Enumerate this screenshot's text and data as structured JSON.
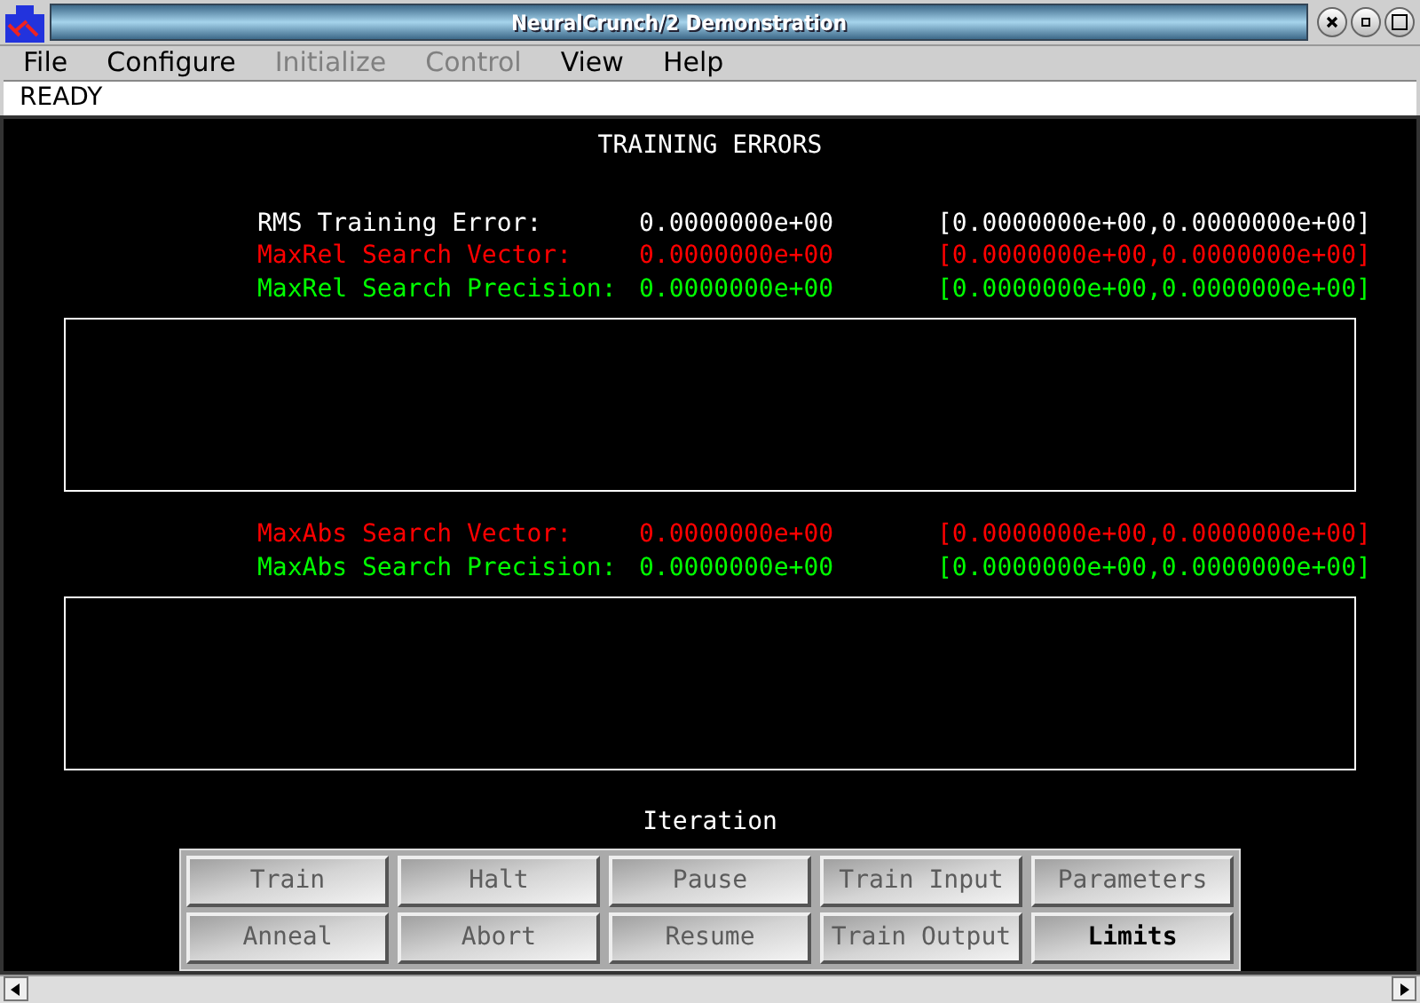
{
  "window": {
    "title": "NeuralCrunch/2 Demonstration"
  },
  "menu": [
    {
      "label": "File",
      "disabled": false
    },
    {
      "label": "Configure",
      "disabled": false
    },
    {
      "label": "Initialize",
      "disabled": true
    },
    {
      "label": "Control",
      "disabled": true
    },
    {
      "label": "View",
      "disabled": false
    },
    {
      "label": "Help",
      "disabled": false
    }
  ],
  "status": "READY",
  "heading": "TRAINING ERRORS",
  "group_1": [
    {
      "label": "RMS Training Error:",
      "value": "0.0000000e+00",
      "range": "[0.0000000e+00,0.0000000e+00]",
      "color": "#ffffff"
    },
    {
      "label": "MaxRel Search Vector:",
      "value": "0.0000000e+00",
      "range": "[0.0000000e+00,0.0000000e+00]",
      "color": "#ff0000"
    },
    {
      "label": "MaxRel Search Precision:",
      "value": "0.0000000e+00",
      "range": "[0.0000000e+00,0.0000000e+00]",
      "color": "#00ff00"
    }
  ],
  "group_2": [
    {
      "label": "MaxAbs Search Vector:",
      "value": "0.0000000e+00",
      "range": "[0.0000000e+00,0.0000000e+00]",
      "color": "#ff0000"
    },
    {
      "label": "MaxAbs Search Precision:",
      "value": "0.0000000e+00",
      "range": "[0.0000000e+00,0.0000000e+00]",
      "color": "#00ff00"
    }
  ],
  "iteration_label": "Iteration",
  "buttons": [
    {
      "label": "Train",
      "disabled": true
    },
    {
      "label": "Halt",
      "disabled": true
    },
    {
      "label": "Pause",
      "disabled": true
    },
    {
      "label": "Train Input",
      "disabled": true
    },
    {
      "label": "Parameters",
      "disabled": true
    },
    {
      "label": "Anneal",
      "disabled": true
    },
    {
      "label": "Abort",
      "disabled": true
    },
    {
      "label": "Resume",
      "disabled": true
    },
    {
      "label": "Train Output",
      "disabled": true
    },
    {
      "label": "Limits",
      "disabled": false
    }
  ]
}
